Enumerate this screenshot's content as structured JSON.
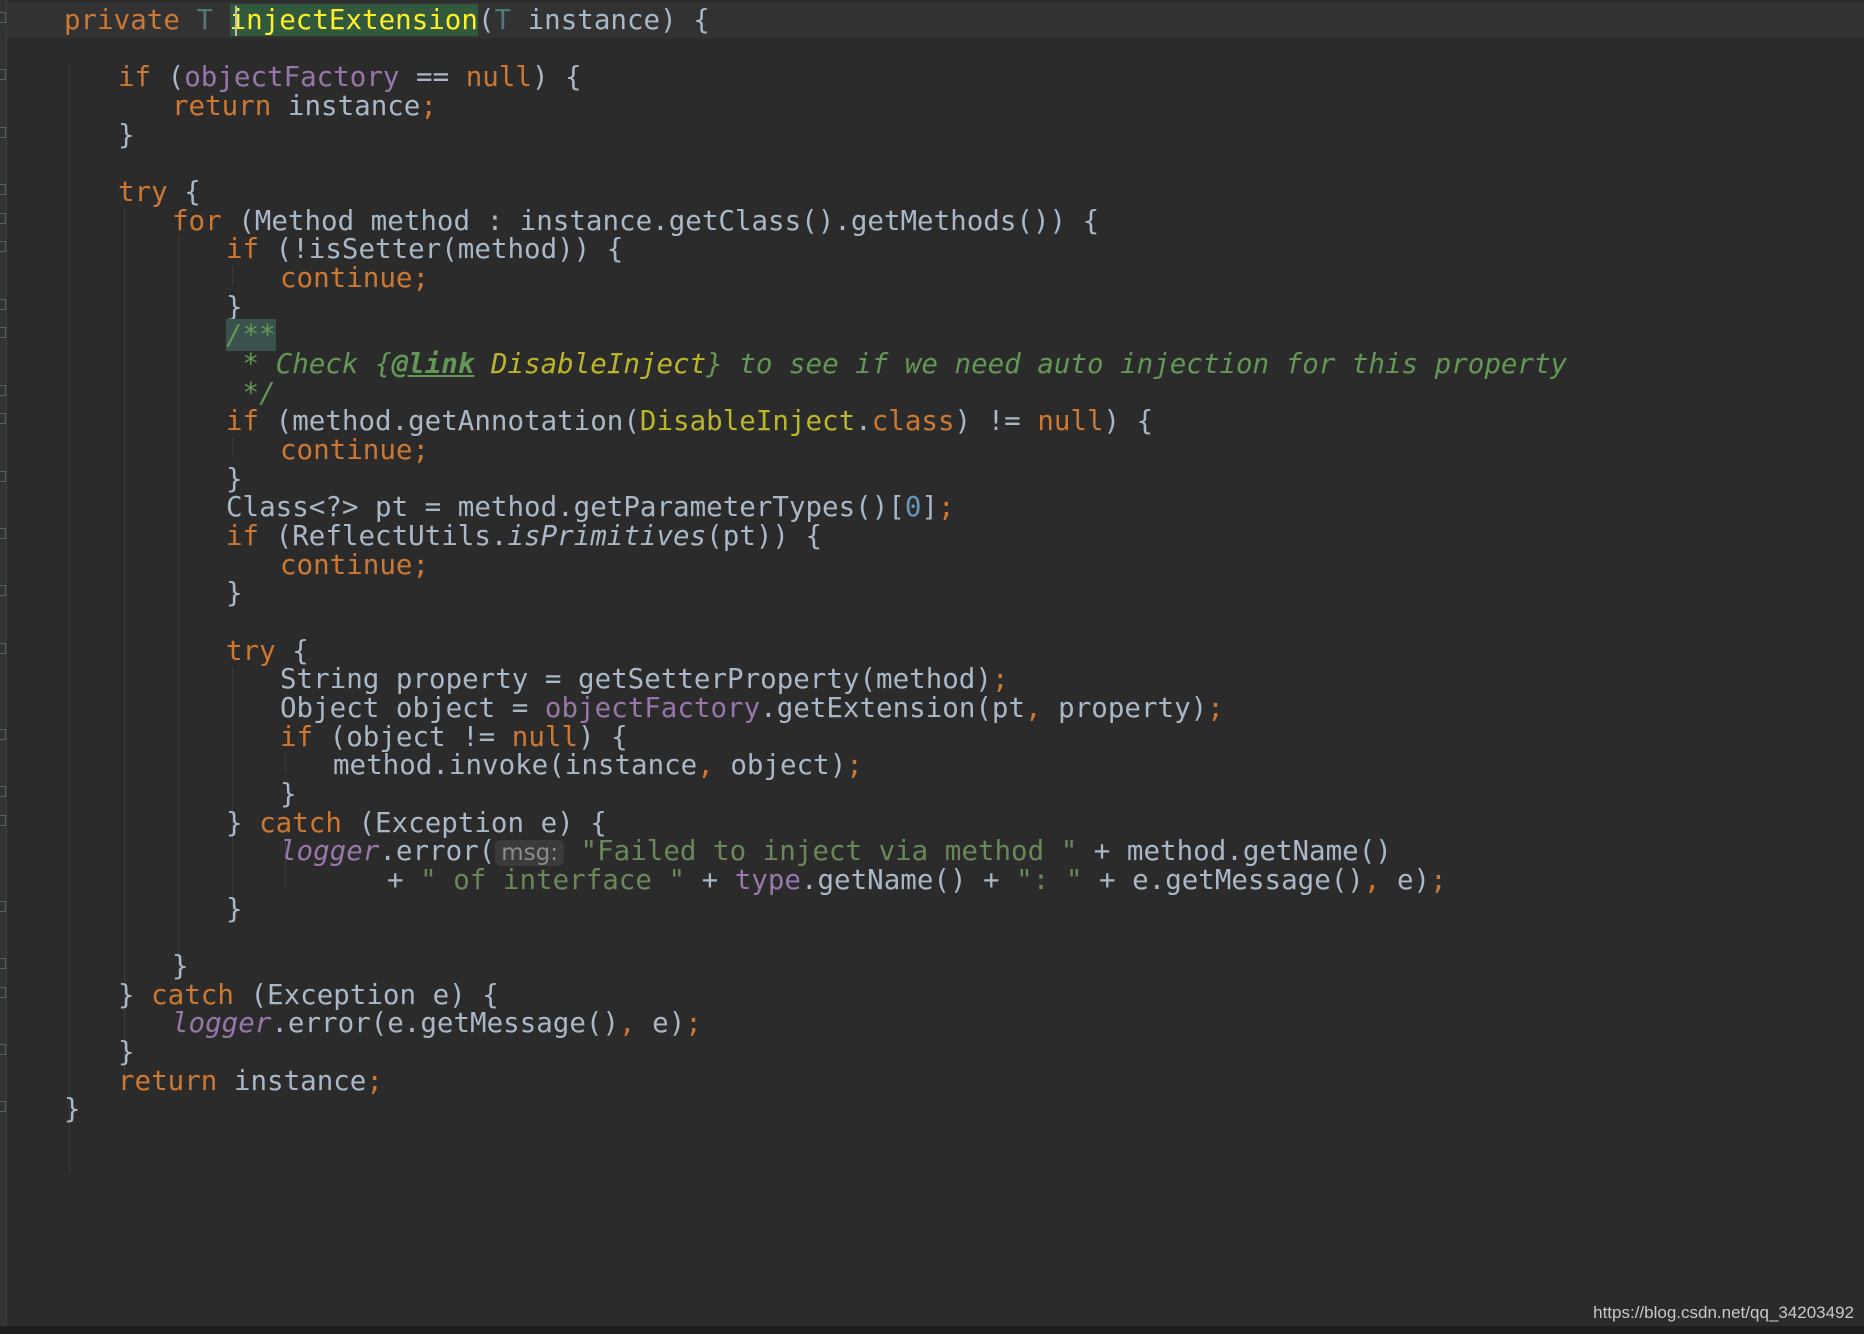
{
  "editor": {
    "watermark": "https://blog.csdn.net/qq_34203492",
    "colors": {
      "background": "#2b2b2b",
      "keyword": "#cc7832",
      "plain": "#a9b7c6",
      "field": "#9876aa",
      "string": "#6a8759",
      "number": "#6897bb",
      "annotation": "#bbb529",
      "doc_comment": "#629755",
      "current_line": "#323232",
      "method_highlight": "#32593d"
    },
    "lines": [
      {
        "indent": 1,
        "tokens": [
          {
            "t": "private ",
            "c": "kw"
          },
          {
            "t": "T ",
            "c": "tp"
          },
          {
            "t": "injectExtension",
            "c": "mhl"
          },
          {
            "t": "(",
            "c": "pl"
          },
          {
            "t": "T ",
            "c": "tp"
          },
          {
            "t": "instance) {",
            "c": "pl"
          }
        ]
      },
      {
        "indent": 0,
        "tokens": []
      },
      {
        "indent": 2,
        "tokens": [
          {
            "t": "if ",
            "c": "kw"
          },
          {
            "t": "(",
            "c": "pl"
          },
          {
            "t": "objectFactory",
            "c": "fld"
          },
          {
            "t": " == ",
            "c": "pl"
          },
          {
            "t": "null",
            "c": "kw"
          },
          {
            "t": ") {",
            "c": "pl"
          }
        ]
      },
      {
        "indent": 3,
        "tokens": [
          {
            "t": "return ",
            "c": "kw"
          },
          {
            "t": "instance",
            "c": "pl"
          },
          {
            "t": ";",
            "c": "kw"
          }
        ]
      },
      {
        "indent": 2,
        "tokens": [
          {
            "t": "}",
            "c": "pl"
          }
        ]
      },
      {
        "indent": 0,
        "tokens": []
      },
      {
        "indent": 2,
        "tokens": [
          {
            "t": "try ",
            "c": "kw"
          },
          {
            "t": "{",
            "c": "pl"
          }
        ]
      },
      {
        "indent": 3,
        "tokens": [
          {
            "t": "for ",
            "c": "kw"
          },
          {
            "t": "(Method method : instance.getClass().getMethods()) {",
            "c": "pl"
          }
        ]
      },
      {
        "indent": 4,
        "tokens": [
          {
            "t": "if ",
            "c": "kw"
          },
          {
            "t": "(!isSetter(method)) {",
            "c": "pl"
          }
        ]
      },
      {
        "indent": 5,
        "tokens": [
          {
            "t": "continue;",
            "c": "kw"
          }
        ]
      },
      {
        "indent": 4,
        "tokens": [
          {
            "t": "}",
            "c": "pl"
          }
        ]
      },
      {
        "indent": 4,
        "tokens": [
          {
            "t": "/**",
            "c": "doc dochl"
          }
        ]
      },
      {
        "indent": 4,
        "tokens": [
          {
            "t": " * Check {",
            "c": "doc"
          },
          {
            "t": "@link",
            "c": "doctag"
          },
          {
            "t": " ",
            "c": "doc"
          },
          {
            "t": "DisableInject",
            "c": "docref"
          },
          {
            "t": "} to see if we need auto injection for this property",
            "c": "doc"
          }
        ]
      },
      {
        "indent": 4,
        "tokens": [
          {
            "t": " */",
            "c": "doc"
          }
        ]
      },
      {
        "indent": 4,
        "tokens": [
          {
            "t": "if ",
            "c": "kw"
          },
          {
            "t": "(method.getAnnotation(",
            "c": "pl"
          },
          {
            "t": "DisableInject",
            "c": "ann"
          },
          {
            "t": ".",
            "c": "pl"
          },
          {
            "t": "class",
            "c": "kw"
          },
          {
            "t": ") != ",
            "c": "pl"
          },
          {
            "t": "null",
            "c": "kw"
          },
          {
            "t": ") {",
            "c": "pl"
          }
        ]
      },
      {
        "indent": 5,
        "tokens": [
          {
            "t": "continue;",
            "c": "kw"
          }
        ]
      },
      {
        "indent": 4,
        "tokens": [
          {
            "t": "}",
            "c": "pl"
          }
        ]
      },
      {
        "indent": 4,
        "tokens": [
          {
            "t": "Class<?> pt = method.getParameterTypes()[",
            "c": "pl"
          },
          {
            "t": "0",
            "c": "num"
          },
          {
            "t": "]",
            "c": "pl"
          },
          {
            "t": ";",
            "c": "kw"
          }
        ]
      },
      {
        "indent": 4,
        "tokens": [
          {
            "t": "if ",
            "c": "kw"
          },
          {
            "t": "(ReflectUtils.",
            "c": "pl"
          },
          {
            "t": "isPrimitives",
            "c": "pl ital"
          },
          {
            "t": "(pt)) {",
            "c": "pl"
          }
        ]
      },
      {
        "indent": 5,
        "tokens": [
          {
            "t": "continue;",
            "c": "kw"
          }
        ]
      },
      {
        "indent": 4,
        "tokens": [
          {
            "t": "}",
            "c": "pl"
          }
        ]
      },
      {
        "indent": 0,
        "tokens": []
      },
      {
        "indent": 4,
        "tokens": [
          {
            "t": "try ",
            "c": "kw"
          },
          {
            "t": "{",
            "c": "pl"
          }
        ]
      },
      {
        "indent": 5,
        "tokens": [
          {
            "t": "String property = getSetterProperty(method)",
            "c": "pl"
          },
          {
            "t": ";",
            "c": "kw"
          }
        ]
      },
      {
        "indent": 5,
        "tokens": [
          {
            "t": "Object object = ",
            "c": "pl"
          },
          {
            "t": "objectFactory",
            "c": "fld"
          },
          {
            "t": ".getExtension(pt",
            "c": "pl"
          },
          {
            "t": ", ",
            "c": "kw"
          },
          {
            "t": "property)",
            "c": "pl"
          },
          {
            "t": ";",
            "c": "kw"
          }
        ]
      },
      {
        "indent": 5,
        "tokens": [
          {
            "t": "if ",
            "c": "kw"
          },
          {
            "t": "(object != ",
            "c": "pl"
          },
          {
            "t": "null",
            "c": "kw"
          },
          {
            "t": ") {",
            "c": "pl"
          }
        ]
      },
      {
        "indent": 6,
        "tokens": [
          {
            "t": "method.invoke(instance",
            "c": "pl"
          },
          {
            "t": ", ",
            "c": "kw"
          },
          {
            "t": "object)",
            "c": "pl"
          },
          {
            "t": ";",
            "c": "kw"
          }
        ]
      },
      {
        "indent": 5,
        "tokens": [
          {
            "t": "}",
            "c": "pl"
          }
        ]
      },
      {
        "indent": 4,
        "tokens": [
          {
            "t": "} ",
            "c": "pl"
          },
          {
            "t": "catch ",
            "c": "kw"
          },
          {
            "t": "(Exception e) {",
            "c": "pl"
          }
        ]
      },
      {
        "indent": 5,
        "tokens": [
          {
            "t": "logger",
            "c": "fld ital"
          },
          {
            "t": ".error(",
            "c": "pl"
          },
          {
            "t": "msg:",
            "c": "hint"
          },
          {
            "t": " \"Failed to inject via method \"",
            "c": "str"
          },
          {
            "t": " + method.getName()",
            "c": "pl"
          }
        ]
      },
      {
        "indent": 7,
        "tokens": [
          {
            "t": "+ ",
            "c": "pl"
          },
          {
            "t": "\" of interface \"",
            "c": "str"
          },
          {
            "t": " + ",
            "c": "pl"
          },
          {
            "t": "type",
            "c": "fld"
          },
          {
            "t": ".getName() + ",
            "c": "pl"
          },
          {
            "t": "\": \"",
            "c": "str"
          },
          {
            "t": " + e.getMessage()",
            "c": "pl"
          },
          {
            "t": ", ",
            "c": "kw"
          },
          {
            "t": "e)",
            "c": "pl"
          },
          {
            "t": ";",
            "c": "kw"
          }
        ]
      },
      {
        "indent": 4,
        "tokens": [
          {
            "t": "}",
            "c": "pl"
          }
        ]
      },
      {
        "indent": 0,
        "tokens": []
      },
      {
        "indent": 3,
        "tokens": [
          {
            "t": "}",
            "c": "pl"
          }
        ]
      },
      {
        "indent": 2,
        "tokens": [
          {
            "t": "} ",
            "c": "pl"
          },
          {
            "t": "catch ",
            "c": "kw"
          },
          {
            "t": "(Exception e) {",
            "c": "pl"
          }
        ]
      },
      {
        "indent": 3,
        "tokens": [
          {
            "t": "logger",
            "c": "fld ital"
          },
          {
            "t": ".error(e.getMessage()",
            "c": "pl"
          },
          {
            "t": ", ",
            "c": "kw"
          },
          {
            "t": "e)",
            "c": "pl"
          },
          {
            "t": ";",
            "c": "kw"
          }
        ]
      },
      {
        "indent": 2,
        "tokens": [
          {
            "t": "}",
            "c": "pl"
          }
        ]
      },
      {
        "indent": 2,
        "tokens": [
          {
            "t": "return ",
            "c": "kw"
          },
          {
            "t": "instance",
            "c": "pl"
          },
          {
            "t": ";",
            "c": "kw"
          }
        ]
      },
      {
        "indent": 1,
        "tokens": [
          {
            "t": "}",
            "c": "pl"
          }
        ]
      }
    ]
  }
}
